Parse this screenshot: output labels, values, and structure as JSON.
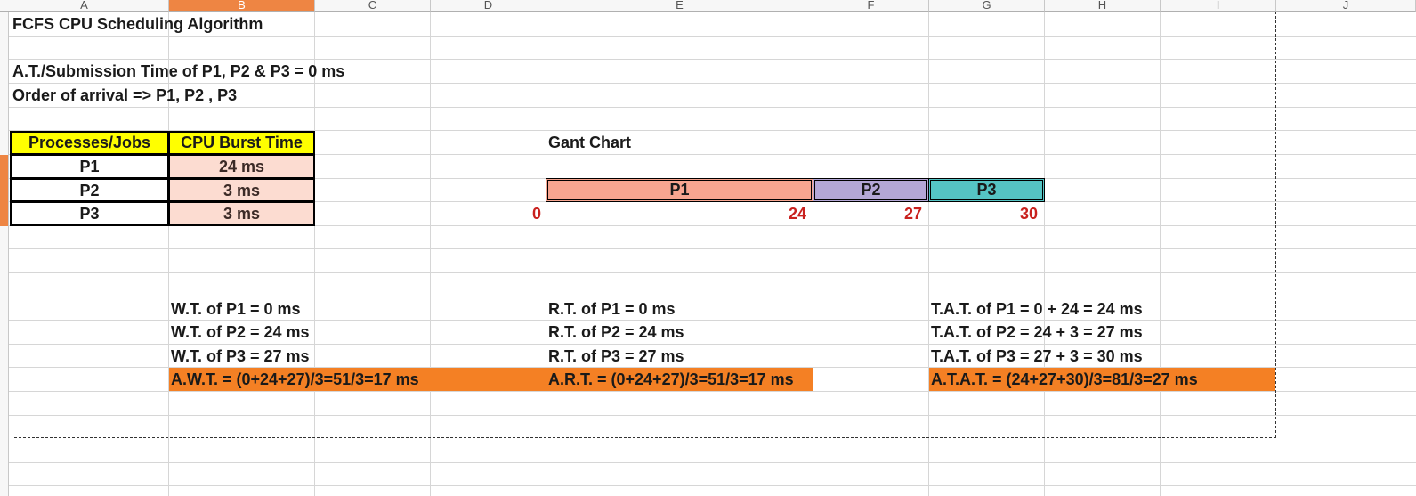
{
  "columns": [
    "A",
    "B",
    "C",
    "D",
    "E",
    "F",
    "G",
    "H",
    "I",
    "J"
  ],
  "title": "FCFS CPU Scheduling Algorithm",
  "notes": {
    "arrival": "A.T./Submission Time of P1, P2 & P3 = 0 ms",
    "order": "Order of arrival => P1, P2 , P3"
  },
  "table": {
    "headers": [
      "Processes/Jobs",
      "CPU Burst Time"
    ],
    "rows": [
      {
        "process": "P1",
        "burst": "24 ms"
      },
      {
        "process": "P2",
        "burst": "3 ms"
      },
      {
        "process": "P3",
        "burst": "3 ms"
      }
    ]
  },
  "gantt": {
    "title": "Gant Chart",
    "blocks": [
      "P1",
      "P2",
      "P3"
    ],
    "times": [
      "0",
      "24",
      "27",
      "30"
    ],
    "colors": {
      "P1": "#f7a590",
      "P2": "#b4a7d6",
      "P3": "#55c4c4"
    }
  },
  "waiting": {
    "p1": "W.T. of P1 =  0 ms",
    "p2": "W.T. of P2 =  24 ms",
    "p3": "W.T. of P3 =  27 ms",
    "avg": "A.W.T. = (0+24+27)/3=51/3=17 ms"
  },
  "response": {
    "p1": "R.T. of P1 = 0 ms",
    "p2": "R.T. of P2 = 24 ms",
    "p3": "R.T. of P3 = 27 ms",
    "avg": "A.R.T. = (0+24+27)/3=51/3=17 ms"
  },
  "turnaround": {
    "p1": "T.A.T. of P1 = 0 + 24 = 24 ms",
    "p2": "T.A.T. of P2 = 24 + 3 = 27 ms",
    "p3": "T.A.T. of P3 = 27 + 3 = 30 ms",
    "avg": "A.T.A.T. = (24+27+30)/3=81/3=27 ms"
  },
  "colors": {
    "header_yellow": "#ffff00",
    "burst_fill": "#fcdcd1",
    "highlight_orange": "#f48024",
    "selection": "#ee8543",
    "time_red": "#c9211e"
  }
}
